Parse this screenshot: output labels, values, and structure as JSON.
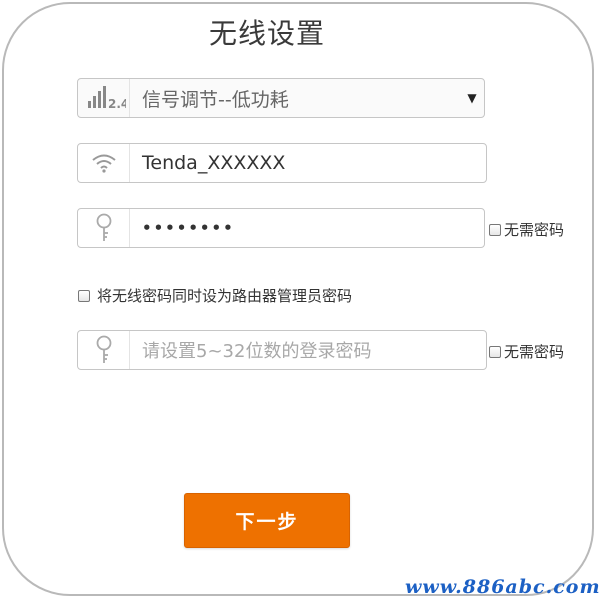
{
  "page": {
    "title": "无线设置"
  },
  "signal": {
    "band_label": "2.4",
    "value": "信号调节--低功耗"
  },
  "ssid": {
    "value": "Tenda_XXXXXX"
  },
  "wifi_password": {
    "value": "••••••••",
    "no_password_label": "无需密码"
  },
  "sync_option": {
    "label": "将无线密码同时设为路由器管理员密码"
  },
  "admin_password": {
    "placeholder": "请设置5~32位数的登录密码",
    "no_password_label": "无需密码"
  },
  "actions": {
    "next_label": "下一步"
  },
  "watermark": {
    "text": "www.886abc.com"
  },
  "colors": {
    "accent": "#ee7100",
    "watermark": "#1c60c4"
  }
}
